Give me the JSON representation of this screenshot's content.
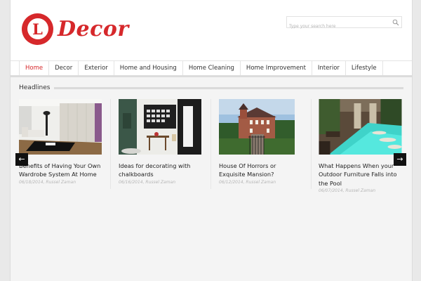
{
  "brand": {
    "logo_letter": "L",
    "logo_text": "Decor",
    "accent": "#d6282b"
  },
  "search": {
    "placeholder": "Type your search here"
  },
  "nav": {
    "items": [
      {
        "label": "Home",
        "active": true
      },
      {
        "label": "Decor"
      },
      {
        "label": "Exterior"
      },
      {
        "label": "Home and Housing"
      },
      {
        "label": "Home Cleaning"
      },
      {
        "label": "Home Improvement"
      },
      {
        "label": "Interior"
      },
      {
        "label": "Lifestyle"
      }
    ]
  },
  "headlines": {
    "title": "Headlines",
    "prev": "←",
    "next": "→",
    "posts": [
      {
        "title": "Benefits of Having Your Own Wardrobe System At Home",
        "date": "06/18/2014",
        "author": "Russel Zaman"
      },
      {
        "title": "Ideas for decorating with chalkboards",
        "date": "06/16/2014",
        "author": "Russel Zaman"
      },
      {
        "title": "House Of Horrors or Exquisite Mansion?",
        "date": "06/12/2014",
        "author": "Russel Zaman"
      },
      {
        "title": "What Happens When your Outdoor Furniture Falls into the Pool",
        "date": "06/07/2014",
        "author": "Russel Zaman"
      }
    ]
  }
}
